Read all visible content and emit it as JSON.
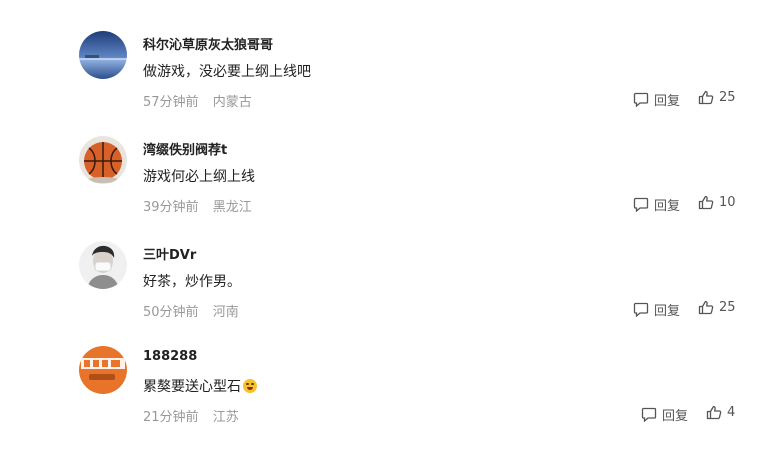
{
  "comments": [
    {
      "username": "科尔沁草原灰太狼哥哥",
      "content": "做游戏，没必要上纲上线吧",
      "time": "57分钟前",
      "location": "内蒙古",
      "reply_label": "回复",
      "likes": "25",
      "avatar_icon": "lake-landscape-avatar"
    },
    {
      "username": "湾缀佚别阀荐t",
      "content": "游戏何必上纲上线",
      "time": "39分钟前",
      "location": "黑龙江",
      "reply_label": "回复",
      "likes": "10",
      "avatar_icon": "basketball-avatar"
    },
    {
      "username": "三叶DVr",
      "content": "好茶，炒作男。",
      "time": "50分钟前",
      "location": "河南",
      "reply_label": "回复",
      "likes": "25",
      "avatar_icon": "masked-person-avatar"
    },
    {
      "username": "188288",
      "content": "累獒要送心型石",
      "content_emoji": "laughing-crying-emoji",
      "time": "21分钟前",
      "location": "江苏",
      "reply_label": "回复",
      "likes": "4",
      "avatar_icon": "orange-jiayou-avatar"
    }
  ]
}
